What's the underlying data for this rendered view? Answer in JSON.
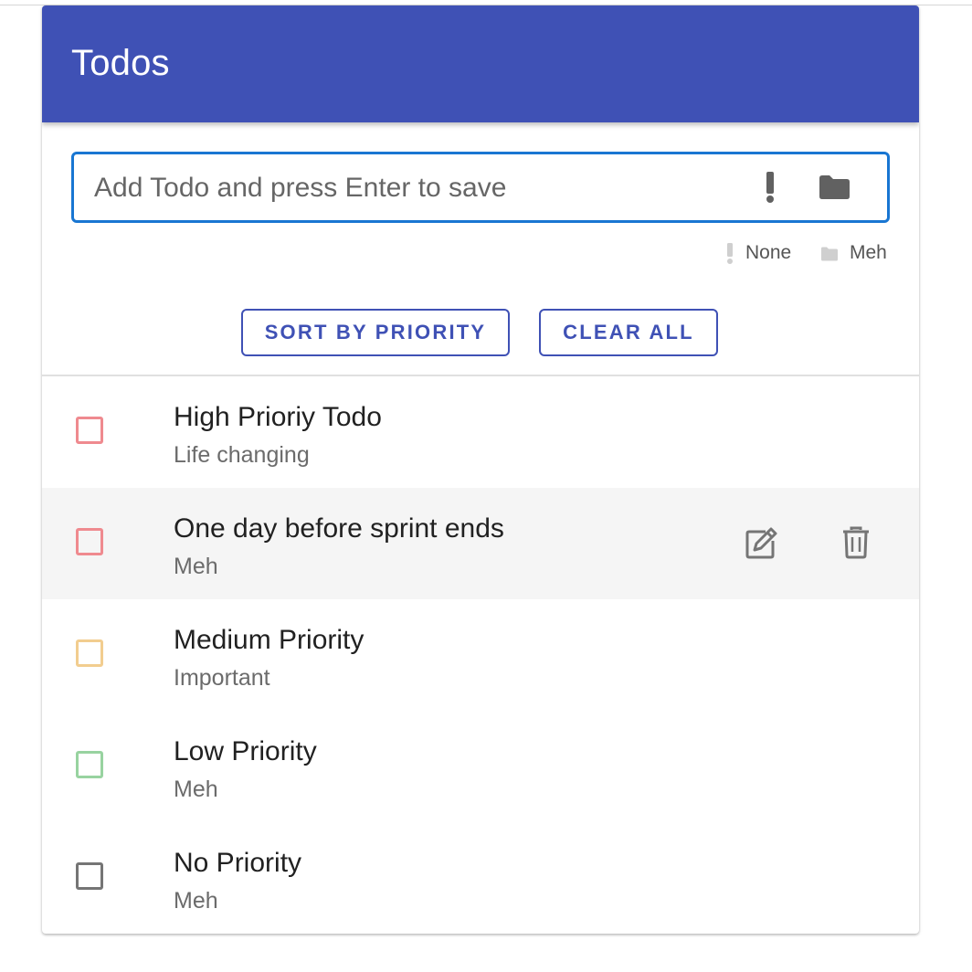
{
  "appbar": {
    "title": "Todos"
  },
  "input": {
    "placeholder": "Add Todo and press Enter to save",
    "priority_icon": "exclamation-icon",
    "project_icon": "folder-icon"
  },
  "selection": {
    "priority_icon": "exclamation-icon",
    "priority_label": "None",
    "project_icon": "folder-icon",
    "project_label": "Meh"
  },
  "actions": {
    "sort_label": "SORT BY PRIORITY",
    "clear_label": "CLEAR ALL"
  },
  "colors": {
    "primary": "#3f51b5",
    "input_focus": "#1976d2",
    "priority_high": "#ef8a8f",
    "priority_medium": "#f2cd8f",
    "priority_low": "#98d3a0",
    "priority_none": "#757575"
  },
  "todos": [
    {
      "title": "High Prioriy Todo",
      "project": "Life changing",
      "priority": "high",
      "checked": false,
      "hovered": false
    },
    {
      "title": "One day before sprint ends",
      "project": "Meh",
      "priority": "high",
      "checked": false,
      "hovered": true,
      "actions": {
        "edit_icon": "edit-icon",
        "delete_icon": "delete-icon"
      }
    },
    {
      "title": "Medium Priority",
      "project": "Important",
      "priority": "medium",
      "checked": false,
      "hovered": false
    },
    {
      "title": "Low Priority",
      "project": "Meh",
      "priority": "low",
      "checked": false,
      "hovered": false
    },
    {
      "title": "No Priority",
      "project": "Meh",
      "priority": "none",
      "checked": false,
      "hovered": false
    }
  ]
}
